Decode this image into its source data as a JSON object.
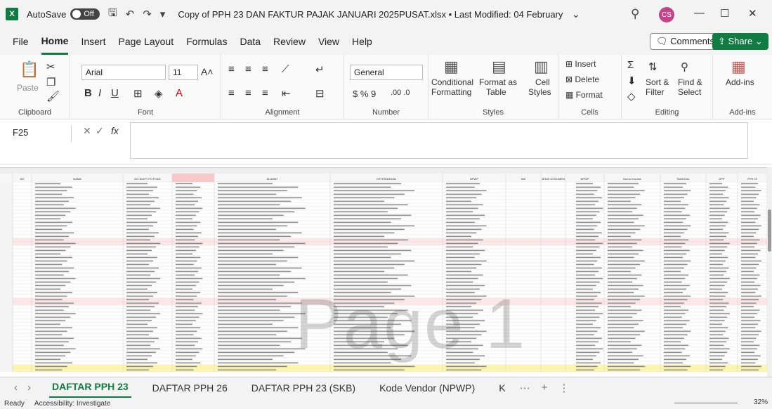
{
  "titlebar": {
    "autosave_label": "AutoSave",
    "toggle_label": "Off",
    "doc_title": "Copy of PPH 23 DAN FAKTUR PAJAK JANUARI 2025PUSAT.xlsx • Last Modified: 04 February",
    "avatar": "CS"
  },
  "menu": [
    "File",
    "Home",
    "Insert",
    "Page Layout",
    "Formulas",
    "Data",
    "Review",
    "View",
    "Help"
  ],
  "active_menu": "Home",
  "comments_label": "Comments",
  "share_label": "Share",
  "ribbon": {
    "clipboard": {
      "label": "Clipboard",
      "paste": "Paste"
    },
    "font": {
      "label": "Font",
      "name": "Arial",
      "size": "11"
    },
    "alignment": {
      "label": "Alignment"
    },
    "number": {
      "label": "Number",
      "format": "General"
    },
    "styles": {
      "label": "Styles",
      "conditional": "Conditional",
      "conditional2": "Formatting",
      "format_as": "Format as",
      "format_as2": "Table",
      "cell": "Cell",
      "cell2": "Styles"
    },
    "cells": {
      "label": "Cells",
      "insert": "Insert",
      "delete": "Delete",
      "format": "Format"
    },
    "editing": {
      "label": "Editing",
      "sort": "Sort &",
      "sort2": "Filter",
      "find": "Find &",
      "find2": "Select"
    },
    "addins": {
      "label": "Add-ins",
      "btn": "Add-ins"
    }
  },
  "namebox": "F25",
  "fx_label": "fx",
  "sheet": {
    "headers": [
      "NO",
      "NAMA",
      "NO BUKTI POTONG",
      "NOMOR BUKTI",
      "ALAMAT",
      "KETERANGAN",
      "NPWP",
      "NIK",
      "JENIS DOKUMEN",
      "NPWP",
      "Nomor Invoice",
      "TANGGAL",
      "DPP",
      "PPH 23"
    ],
    "watermark": "Page 1"
  },
  "tabs": [
    "DAFTAR PPH 23",
    "DAFTAR PPH 26",
    "DAFTAR PPH 23 (SKB)",
    "Kode Vendor (NPWP)",
    "K"
  ],
  "status": {
    "ready": "Ready",
    "accessibility": "Accessibility: Investigate",
    "zoom": "32%"
  }
}
